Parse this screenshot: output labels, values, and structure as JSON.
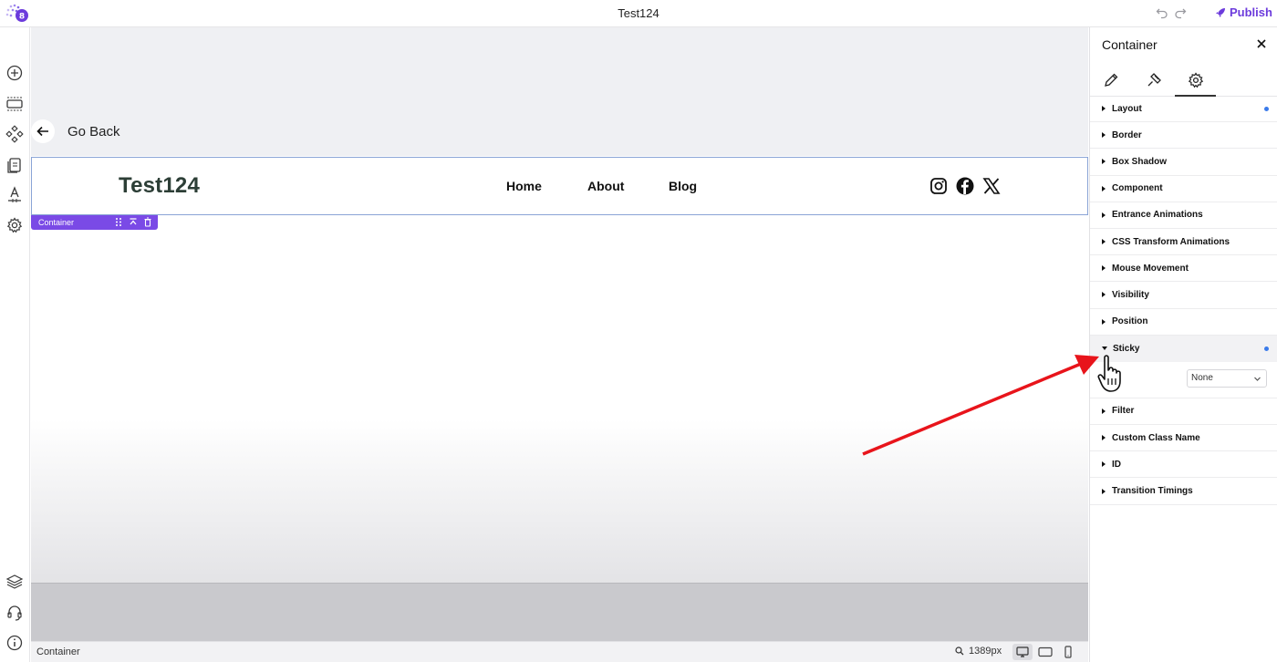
{
  "app": {
    "document_title": "Test124",
    "publish_label": "Publish",
    "accent": "#6c3bdc"
  },
  "left_rail": {
    "top_icons": [
      "add-icon",
      "section-icon",
      "components-icon",
      "pages-icon",
      "typography-icon",
      "settings-icon"
    ],
    "bottom_icons": [
      "layers-icon",
      "support-icon",
      "info-icon"
    ]
  },
  "canvas": {
    "go_back_label": "Go Back",
    "site_header": {
      "logo_text": "Test124",
      "nav": [
        "Home",
        "About",
        "Blog"
      ],
      "social_icons": [
        "instagram-icon",
        "facebook-icon",
        "x-twitter-icon"
      ]
    },
    "selection_tag": {
      "label": "Container"
    }
  },
  "status_bar": {
    "selected_label": "Container",
    "width_readout": "1389px",
    "active_device": "desktop"
  },
  "panel": {
    "title": "Container",
    "tabs": [
      "edit-tab",
      "style-tab",
      "settings-tab"
    ],
    "active_tab": "settings-tab",
    "sections": [
      {
        "label": "Layout",
        "modified": true
      },
      {
        "label": "Border"
      },
      {
        "label": "Box Shadow"
      },
      {
        "label": "Component"
      },
      {
        "label": "Entrance Animations"
      },
      {
        "label": "CSS Transform Animations"
      },
      {
        "label": "Mouse Movement"
      },
      {
        "label": "Visibility"
      },
      {
        "label": "Position"
      },
      {
        "label": "Sticky",
        "modified": true,
        "expanded": true
      },
      {
        "label": "Filter"
      },
      {
        "label": "Custom Class Name"
      },
      {
        "label": "ID"
      },
      {
        "label": "Transition Timings"
      }
    ],
    "sticky_select": {
      "value": "None"
    }
  },
  "annotation": {
    "arrow_color": "#e8141b"
  }
}
